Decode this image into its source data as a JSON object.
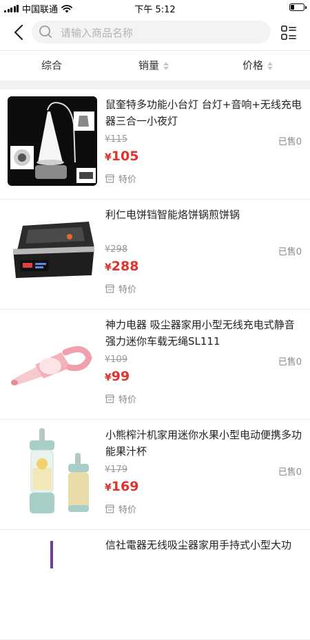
{
  "status_bar": {
    "carrier": "中国联通",
    "time": "下午 5:12"
  },
  "header": {
    "search_placeholder": "请输入商品名称"
  },
  "sort_bar": {
    "items": [
      "综合",
      "销量",
      "价格"
    ]
  },
  "colors": {
    "price_red": "#e4312a",
    "background": "#f2f2f2"
  },
  "products": [
    {
      "title": "鼠奎特多功能小台灯 台灯+音响+无线充电器三合一小夜灯",
      "original_price": "¥115",
      "currency": "¥",
      "price": "105",
      "sold": "已售0",
      "tag": "特价"
    },
    {
      "title": "利仁电饼铛智能烙饼锅煎饼锅",
      "original_price": "¥298",
      "currency": "¥",
      "price": "288",
      "sold": "已售0",
      "tag": "特价"
    },
    {
      "title": "神力电器 吸尘器家用小型无线充电式静音强力迷你车载无绳SL111",
      "original_price": "¥109",
      "currency": "¥",
      "price": "99",
      "sold": "已售0",
      "tag": "特价"
    },
    {
      "title": "小熊榨汁机家用迷你水果小型电动便携多功能果汁杯",
      "original_price": "¥179",
      "currency": "¥",
      "price": "169",
      "sold": "已售0",
      "tag": "特价"
    },
    {
      "title": "信社電器无线吸尘器家用手持式小型大功"
    }
  ]
}
